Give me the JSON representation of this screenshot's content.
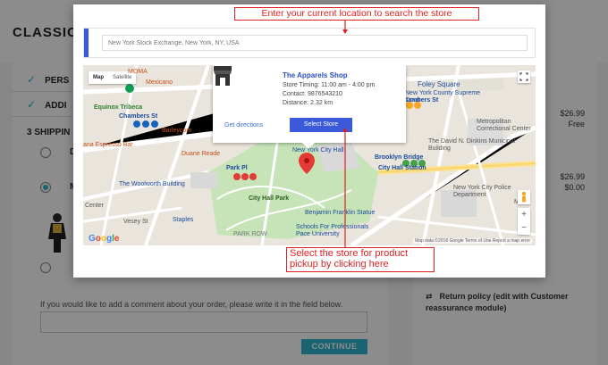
{
  "page": {
    "title": "CLASSIC",
    "steps": [
      {
        "label": "PERS",
        "check": "✓"
      },
      {
        "label": "ADDI",
        "check": "✓"
      },
      {
        "label": "3   SHIPPIN"
      }
    ],
    "carrier_letters": [
      "D",
      "M"
    ],
    "comment_label": "If you would like to add a comment about your order, please write it in the field below.",
    "continue_label": "CONTINUE"
  },
  "cart": {
    "prices": [
      {
        "amount": "$26.99",
        "note": "Free"
      },
      {
        "amount": "$26.99",
        "note": "$0.00"
      }
    ],
    "return_policy": "Return policy (edit with Customer reassurance module)"
  },
  "modal": {
    "search_placeholder": "New York Stock Exchange, New York, NY, USA",
    "annotation_top": "Enter your current location to search the store",
    "annotation_bottom": "Select the store for product pickup by clicking here"
  },
  "map": {
    "tabs": {
      "map": "Map",
      "satellite": "Satellite"
    },
    "labels": {
      "moma": "MOMA",
      "mexicano": "Mexicano",
      "equinox": "Equinox Tribeca",
      "chambers_w": "Chambers St",
      "anana": "ana Espresso Bar",
      "duane": "Duane Reade",
      "barleycorn": "Barleycorn",
      "woolworth": "The Woolworth Building",
      "park_pl": "Park Pl",
      "cityhall_park": "City Hall Park",
      "staples": "Staples",
      "vesey": "Vesey St",
      "center": "Center",
      "nyc_hall": "New York City Hall",
      "brooklyn_bridge": "Brooklyn Bridge",
      "city_hall_station": "City Hall Station",
      "foley": "Foley Square",
      "nyc_court": "New York County Supreme Court",
      "chambers_e": "Chambers St",
      "metropolitan": "Metropolitan Correctional Center",
      "david_dinkins": "The David N. Dinkins Municipal Building",
      "nypd": "New York City Police Department",
      "franklin": "Benjamin Franklin Statue",
      "pace": "Pace University",
      "pace_schools": "Schools For Professionals",
      "park_row": "PARK ROW",
      "mto": "MTO"
    },
    "footer": "Map data ©2018 Google   Terms of Use   Report a map error",
    "google": "Google"
  },
  "store": {
    "name": "The Apparels Shop",
    "timing": "Store Timing: 11:00 am - 4:00 pm",
    "contact": "Contact: 9876543210",
    "distance": "Distance: 2.32 km",
    "directions_label": "Get directions",
    "select_label": "Select Store"
  },
  "colors": {
    "accent": "#3a5ad9",
    "annotation": "#dd2222",
    "continue": "#2fb5d2"
  }
}
